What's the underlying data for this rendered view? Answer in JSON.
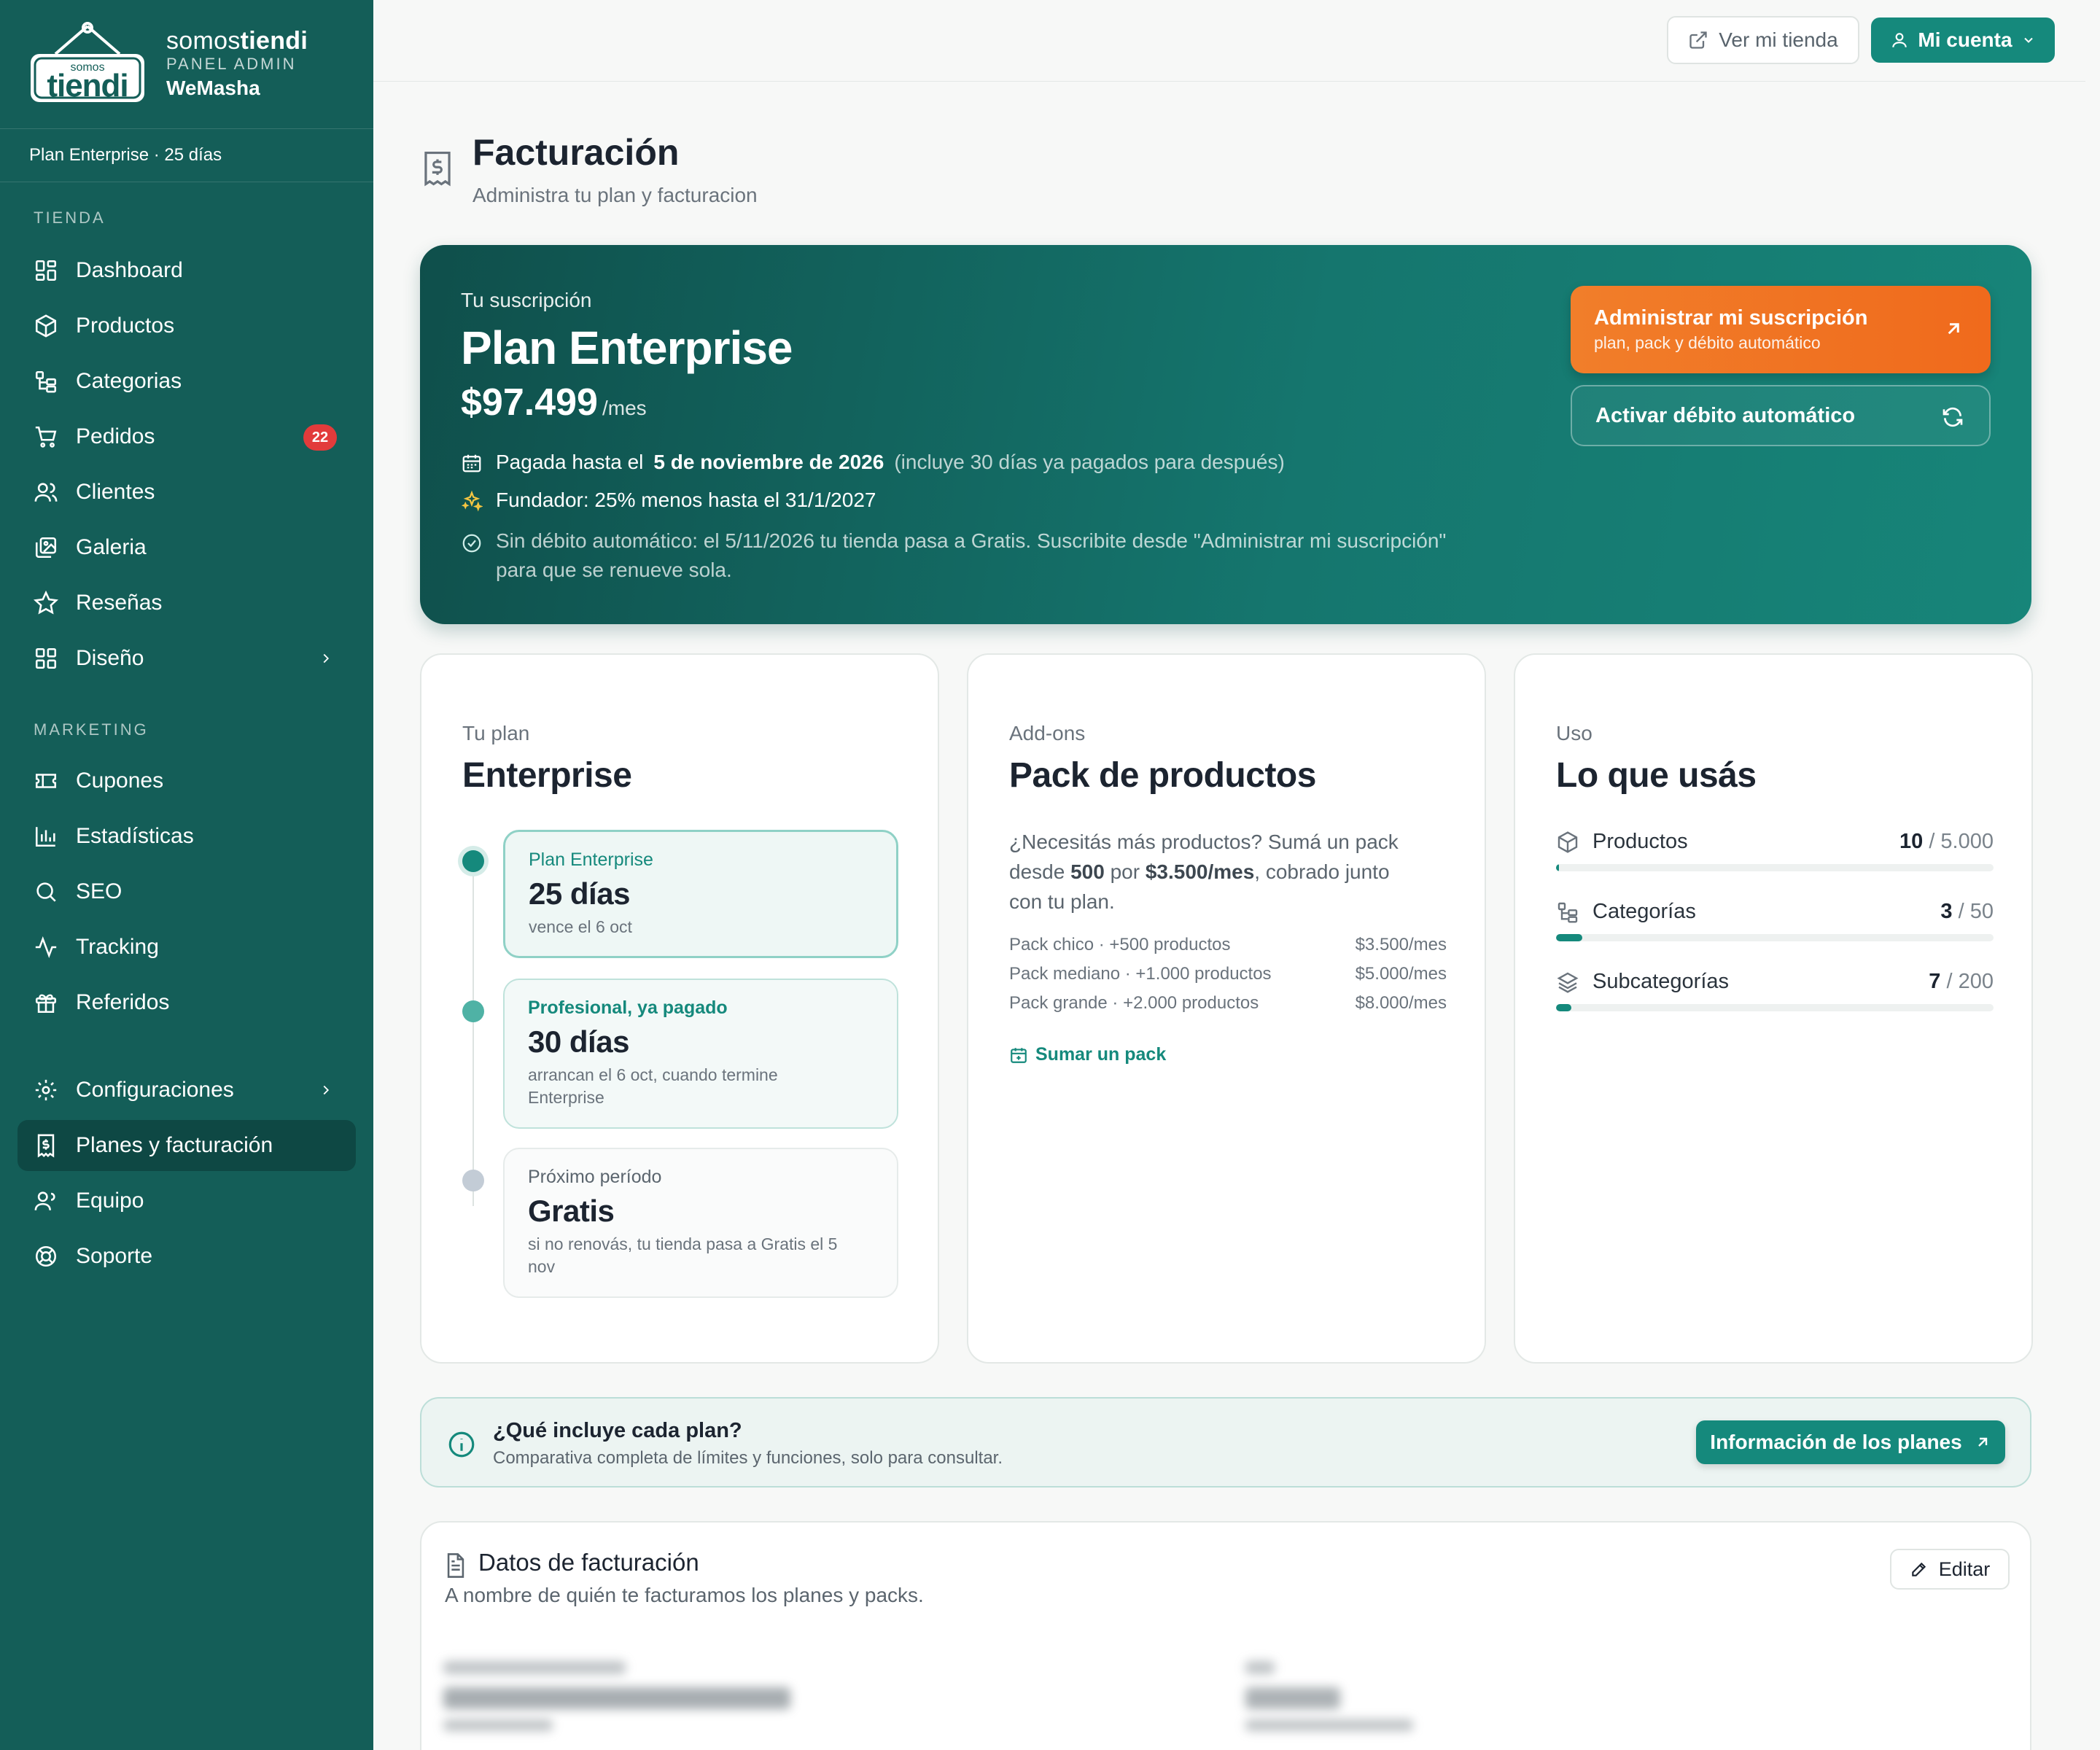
{
  "brand": {
    "sign_word_small": "somos",
    "sign_word": "tiendi",
    "name_light": "somos",
    "name_bold": "tiendi",
    "subtitle": "PANEL ADMIN",
    "store": "WeMasha",
    "plan_strip": "Plan Enterprise · 25 días"
  },
  "sidebar": {
    "section_store": "TIENDA",
    "section_marketing": "MARKETING",
    "items": [
      {
        "label": "Dashboard",
        "icon": "grid-icon"
      },
      {
        "label": "Productos",
        "icon": "box-icon"
      },
      {
        "label": "Categorias",
        "icon": "tree-icon"
      },
      {
        "label": "Pedidos",
        "icon": "cart-icon",
        "badge": "22"
      },
      {
        "label": "Clientes",
        "icon": "users-icon"
      },
      {
        "label": "Galeria",
        "icon": "images-icon"
      },
      {
        "label": "Reseñas",
        "icon": "star-icon"
      },
      {
        "label": "Diseño",
        "icon": "layout-icon"
      },
      {
        "label": "Cupones",
        "icon": "ticket-icon"
      },
      {
        "label": "Estadísticas",
        "icon": "chart-icon"
      },
      {
        "label": "SEO",
        "icon": "search-icon"
      },
      {
        "label": "Tracking",
        "icon": "pulse-icon"
      },
      {
        "label": "Referidos",
        "icon": "gift-icon"
      },
      {
        "label": "Configuraciones",
        "icon": "gear-icon"
      },
      {
        "label": "Planes y facturación",
        "icon": "receipt-icon",
        "active": true
      },
      {
        "label": "Equipo",
        "icon": "team-icon"
      },
      {
        "label": "Soporte",
        "icon": "lifebuoy-icon"
      }
    ]
  },
  "topbar": {
    "view_store": "Ver mi tienda",
    "account": "Mi cuenta"
  },
  "header": {
    "title": "Facturación",
    "subtitle": "Administra tu plan y facturacion"
  },
  "subscription": {
    "label": "Tu suscripción",
    "plan": "Plan Enterprise",
    "price": "$97.499",
    "period": "/mes",
    "paid_prefix": "Pagada hasta el",
    "paid_date": "5 de noviembre de 2026",
    "paid_note": "(incluye 30 días ya pagados para después)",
    "founder": "Fundador: 25% menos hasta el 31/1/2027",
    "autodebit_line1": "Sin débito automático: el 5/11/2026 tu tienda pasa a Gratis. Suscribite desde \"Administrar mi suscripción\"",
    "autodebit_line2": "para que se renueve sola.",
    "cta_manage": "Administrar mi suscripción",
    "cta_manage_sub": "plan, pack y débito automático",
    "cta_autodebit": "Activar débito automático"
  },
  "plan_card": {
    "eyebrow": "Tu plan",
    "title": "Enterprise",
    "timeline": [
      {
        "kicker": "Plan Enterprise",
        "value": "25 días",
        "note": "vence el 6 oct"
      },
      {
        "kicker": "Profesional, ya pagado",
        "value": "30 días",
        "note_line1": "arrancan el 6 oct, cuando termine",
        "note_line2": "Enterprise"
      },
      {
        "kicker": "Próximo período",
        "value": "Gratis",
        "note_line1": "si no renovás, tu tienda pasa a Gratis el 5",
        "note_line2": "nov"
      }
    ]
  },
  "addons_card": {
    "eyebrow": "Add-ons",
    "title": "Pack de productos",
    "desc_a": "¿Necesitás más productos? Sumá un pack",
    "desc_b1": "desde ",
    "desc_b_qty": "500",
    "desc_b2": " por ",
    "desc_b_price": "$3.500/mes",
    "desc_b3": ", cobrado junto",
    "desc_c": "con tu plan.",
    "packs": [
      {
        "name": "Pack chico · +500 productos",
        "price": "$3.500/mes"
      },
      {
        "name": "Pack mediano · +1.000 productos",
        "price": "$5.000/mes"
      },
      {
        "name": "Pack grande · +2.000 productos",
        "price": "$8.000/mes"
      }
    ],
    "add_pack": "Sumar un pack"
  },
  "usage_card": {
    "eyebrow": "Uso",
    "title": "Lo que usás",
    "rows": [
      {
        "label": "Productos",
        "used": "10",
        "limit": "/ 5.000",
        "fraction": 0.002
      },
      {
        "label": "Categorías",
        "used": "3",
        "limit": "/ 50",
        "fraction": 0.06
      },
      {
        "label": "Subcategorías",
        "used": "7",
        "limit": "/ 200",
        "fraction": 0.035
      }
    ]
  },
  "info": {
    "question": "¿Qué incluye cada plan?",
    "desc": "Comparativa completa de límites y funciones, solo para consultar.",
    "button": "Información de los planes"
  },
  "billing": {
    "title": "Datos de facturación",
    "desc": "A nombre de quién te facturamos los planes y packs.",
    "edit": "Editar"
  },
  "colors": {
    "sidebar": "#145e58",
    "accent": "#15897c",
    "orange": "#f17e2a",
    "badge": "#e23b3b"
  }
}
